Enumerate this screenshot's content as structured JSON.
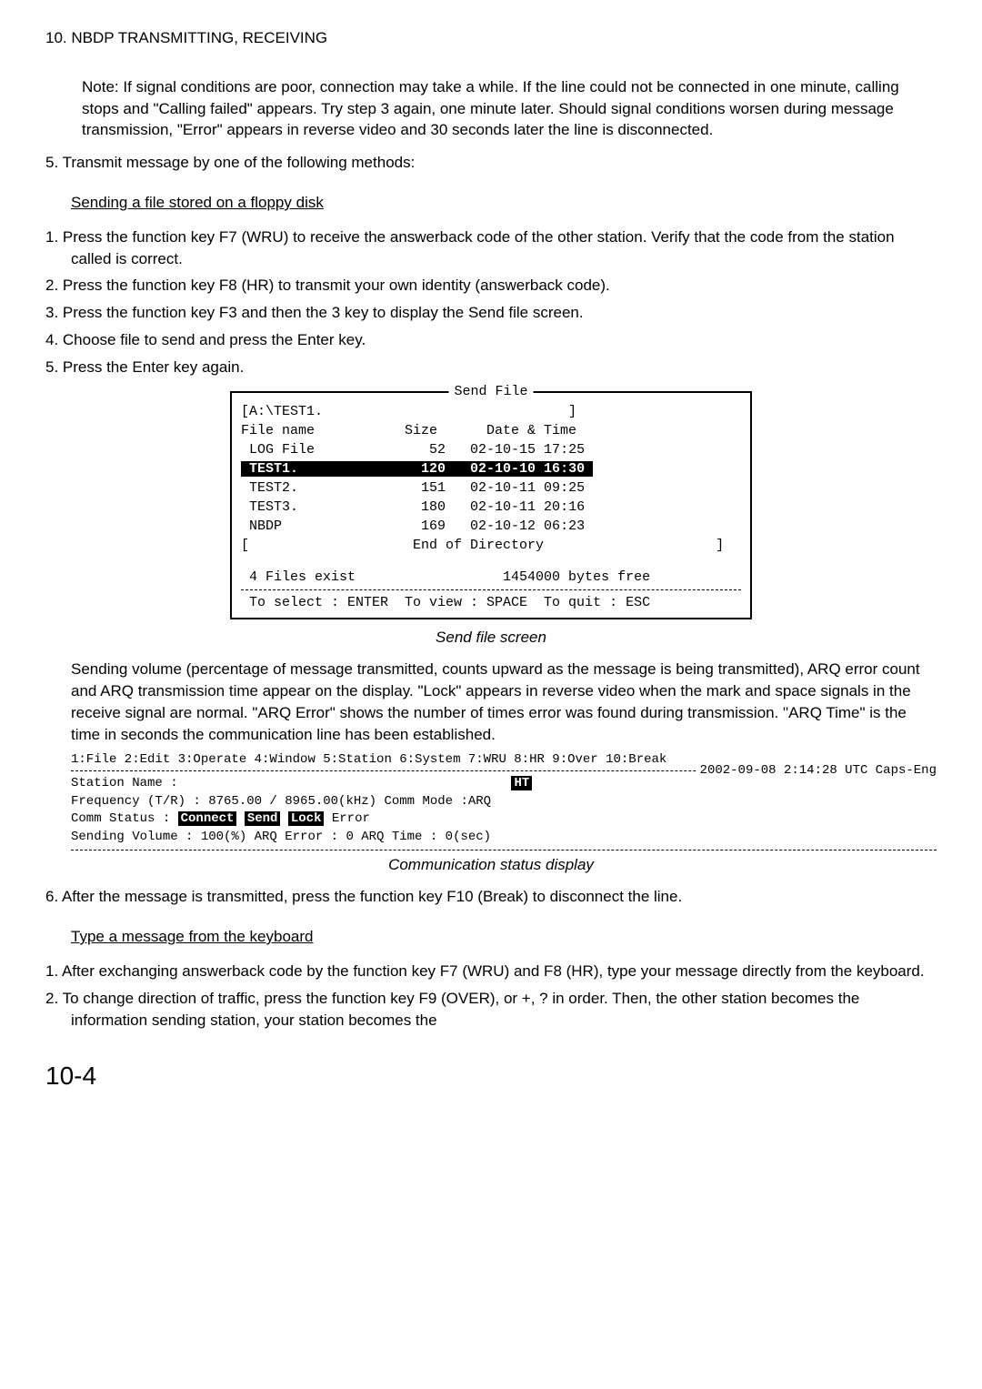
{
  "header": "10. NBDP TRANSMITTING, RECEIVING",
  "note": {
    "label": "Note:",
    "text": "If signal conditions are poor, connection may take a while. If the line could not be connected in one minute, calling stops and \"Calling failed\" appears. Try step 3 again, one minute later. Should signal conditions worsen during message transmission, \"Error\" appears in reverse video and 30 seconds later the line is disconnected."
  },
  "top_step5": "5.  Transmit message by one of the following methods:",
  "sectionA_heading": "Sending a file stored on a floppy disk",
  "sectionA_steps": [
    "1.  Press the function key F7 (WRU) to receive the answerback code of the other station. Verify that the code from the station called is correct.",
    "2.  Press the function key F8 (HR) to transmit your own identity (answerback code).",
    "3.  Press the function key F3 and then the 3 key to display the Send file screen.",
    "4.  Choose file to send and press the Enter key.",
    "5.  Press the Enter key again."
  ],
  "send_file": {
    "title": "Send File",
    "path": "[A:\\TEST1.                              ]",
    "cols_line": "File name           Size      Date & Time",
    "rows": [
      {
        "name": " LOG File            ",
        "size": "  52   ",
        "dt": "02-10-15 17:25 "
      },
      {
        "name": " TEST1.              ",
        "size": " 120   ",
        "dt": "02-10-10 16:30 ",
        "selected": true
      },
      {
        "name": " TEST2.              ",
        "size": " 151   ",
        "dt": "02-10-11 09:25 "
      },
      {
        "name": " TEST3.              ",
        "size": " 180   ",
        "dt": "02-10-11 20:16 "
      },
      {
        "name": " NBDP                ",
        "size": " 169   ",
        "dt": "02-10-12 06:23 "
      }
    ],
    "end_dir": "[                    End of Directory                     ]",
    "files_exist": " 4 Files exist                  1454000 bytes free",
    "footer": " To select : ENTER  To view : SPACE  To quit : ESC"
  },
  "send_file_caption": "Send file screen",
  "sending_para": "Sending volume (percentage of message transmitted, counts upward as the message is being transmitted), ARQ error count and ARQ transmission time appear on the display. \"Lock\" appears in reverse video when the mark and space signals in the receive signal are normal. \"ARQ Error\" shows the number of times error was found during transmission. \"ARQ Time\" is the time in seconds the communication line has been established.",
  "comm_status": {
    "menu": "1:File 2:Edit 3:Operate 4:Window 5:Station 6:System 7:WRU 8:HR 9:Over 10:Break",
    "date_line": "2002-09-08 2:14:28 UTC       Caps-Eng",
    "station_label": " Station Name    :",
    "station_badge": "HT",
    "freq": " Frequency (T/R) :   8765.00 / 8965.00(kHz)  Comm Mode :ARQ",
    "comm_label": " Comm Status     :  ",
    "comm_connect": "Connect",
    "comm_send": "Send",
    "comm_lock": "Lock",
    "comm_error": " Error",
    "sending_vol": " Sending Volume  :  100(%)   ARQ Error : 0   ARQ Time : 0(sec)"
  },
  "comm_caption": "Communication status display",
  "step6": "6.  After the message is transmitted, press the function key F10 (Break) to disconnect the line.",
  "sectionB_heading": "Type a message from the keyboard",
  "sectionB_steps": [
    "1.  After exchanging answerback code by the function key F7 (WRU) and F8 (HR), type your message directly from the keyboard.",
    "2.  To change direction of traffic, press the function key F9 (OVER), or +, ? in order. Then, the other station becomes the information sending station, your station becomes the"
  ],
  "page_number": "10-4"
}
